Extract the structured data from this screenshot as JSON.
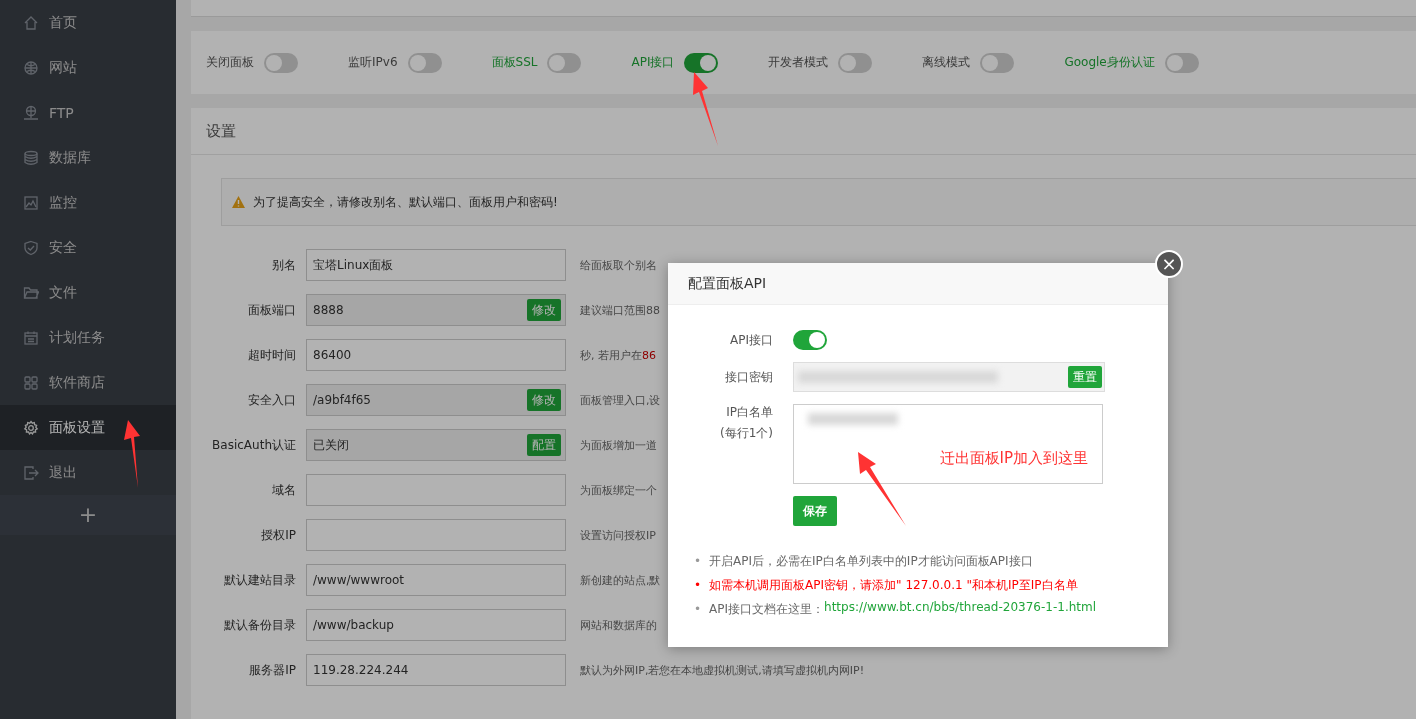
{
  "sidebar": {
    "items": [
      {
        "label": "首页",
        "selected": false
      },
      {
        "label": "网站",
        "selected": false
      },
      {
        "label": "FTP",
        "selected": false
      },
      {
        "label": "数据库",
        "selected": false
      },
      {
        "label": "监控",
        "selected": false
      },
      {
        "label": "安全",
        "selected": false
      },
      {
        "label": "文件",
        "selected": false
      },
      {
        "label": "计划任务",
        "selected": false
      },
      {
        "label": "软件商店",
        "selected": false
      },
      {
        "label": "面板设置",
        "selected": true
      },
      {
        "label": "退出",
        "selected": false
      }
    ],
    "add_button": "+"
  },
  "toggles": [
    {
      "label": "关闭面板",
      "link": false,
      "on": false
    },
    {
      "label": "监听IPv6",
      "link": false,
      "on": false
    },
    {
      "label": "面板SSL",
      "link": true,
      "on": false
    },
    {
      "label": "API接口",
      "link": true,
      "on": true
    },
    {
      "label": "开发者模式",
      "link": false,
      "on": false
    },
    {
      "label": "离线模式",
      "link": false,
      "on": false
    },
    {
      "label": "Google身份认证",
      "link": true,
      "on": false
    }
  ],
  "settings": {
    "title": "设置",
    "warning": "为了提高安全，请修改别名、默认端口、面板用户和密码!",
    "rows": [
      {
        "label": "别名",
        "value": "宝塔Linux面板",
        "description": "给面板取个别名"
      },
      {
        "label": "面板端口",
        "value": "8888",
        "button": "修改",
        "description": "建议端口范围88"
      },
      {
        "label": "超时时间",
        "value": "86400",
        "description": "秒, 若用户在",
        "description_red": "86"
      },
      {
        "label": "安全入口",
        "value": "/a9bf4f65",
        "button": "修改",
        "description": "面板管理入口,设"
      },
      {
        "label": "BasicAuth认证",
        "value": "已关闭",
        "button": "配置",
        "description": "为面板增加一道"
      },
      {
        "label": "域名",
        "description": "为面板绑定一个"
      },
      {
        "label": "授权IP",
        "description": "设置访问授权IP"
      },
      {
        "label": "默认建站目录",
        "value": "/www/wwwroot",
        "description": "新创建的站点,默"
      },
      {
        "label": "默认备份目录",
        "value": "/www/backup",
        "description": "网站和数据库的"
      },
      {
        "label": "服务器IP",
        "value": "119.28.224.244",
        "description": "默认为外网IP,若您在本地虚拟机测试,请填写虚拟机内网IP!"
      }
    ]
  },
  "dialog": {
    "title": "配置面板API",
    "close": "×",
    "api_label": "API接口",
    "api_on": true,
    "key_label": "接口密钥",
    "key_button": "重置",
    "whitelist_label": "IP白名单",
    "whitelist_hint": "(每行1个)",
    "save_button": "保存",
    "notes": [
      {
        "kind": "normal",
        "bullet": "•",
        "text": "开启API后，必需在IP白名单列表中的IP才能访问面板API接口"
      },
      {
        "kind": "warning",
        "bullet": "•",
        "text": "如需本机调用面板API密钥，请添加\" 127.0.0.1 \"和本机IP至IP白名单"
      },
      {
        "kind": "link",
        "bullet": "•",
        "text": "API接口文档在这里：",
        "link": "https://www.bt.cn/bbs/thread-20376-1-1.html"
      }
    ]
  },
  "annotation": {
    "text": "迁出面板IP加入到这里"
  }
}
